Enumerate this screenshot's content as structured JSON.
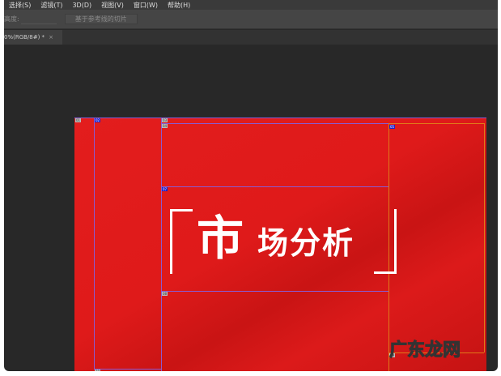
{
  "menu": [
    "选择(S)",
    "滤镜(T)",
    "3D(D)",
    "视图(V)",
    "窗口(W)",
    "帮助(H)"
  ],
  "options": {
    "height_label": "高度:",
    "slices_button": "基于参考线的切片"
  },
  "document_tab": {
    "title": "0%(RGB/8#) *",
    "close": "×"
  },
  "canvas": {
    "title_big": "市",
    "title_rest": "场分析"
  },
  "slices": [
    "01",
    "02",
    "03",
    "04",
    "05",
    "07",
    "08",
    "09",
    "10"
  ],
  "watermark": "广东龙网"
}
